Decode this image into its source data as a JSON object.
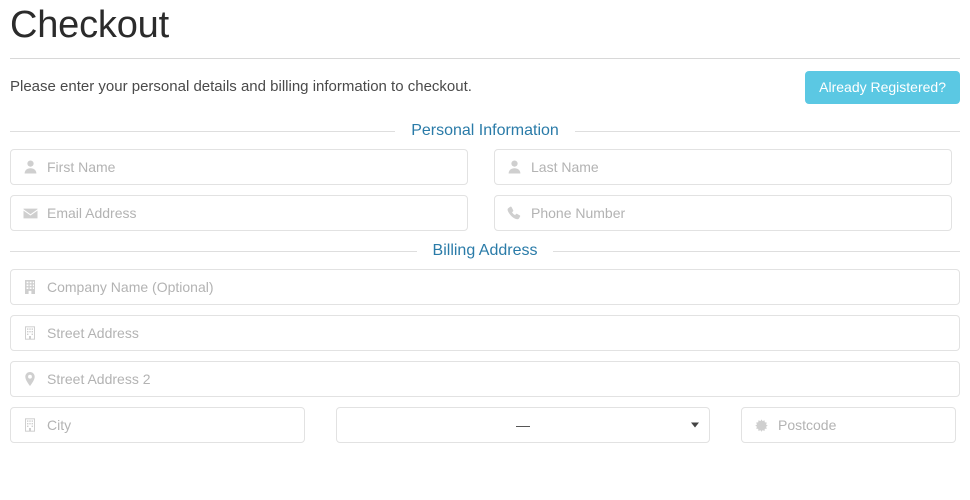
{
  "header": {
    "title": "Checkout",
    "intro": "Please enter your personal details and billing information to checkout.",
    "registered_button": "Already Registered?",
    "registered_button_color": "#5bc8e3"
  },
  "sections": [
    {
      "id": "personal",
      "label": "Personal Information",
      "color": "#2a7ba8"
    },
    {
      "id": "billing",
      "label": "Billing Address",
      "color": "#2a7ba8"
    }
  ],
  "personal_fields": [
    {
      "name": "first-name",
      "icon": "user-icon",
      "placeholder": "First Name",
      "value": ""
    },
    {
      "name": "last-name",
      "icon": "user-icon",
      "placeholder": "Last Name",
      "value": ""
    },
    {
      "name": "email-address",
      "icon": "envelope-icon",
      "placeholder": "Email Address",
      "value": ""
    },
    {
      "name": "phone-number",
      "icon": "phone-icon",
      "placeholder": "Phone Number",
      "value": ""
    }
  ],
  "billing_fields": [
    {
      "name": "company-name",
      "icon": "building-icon",
      "placeholder": "Company Name (Optional)",
      "value": ""
    },
    {
      "name": "street-address",
      "icon": "building-outline-icon",
      "placeholder": "Street Address",
      "value": ""
    },
    {
      "name": "street-address-2",
      "icon": "map-marker-icon",
      "placeholder": "Street Address 2",
      "value": ""
    },
    {
      "name": "city",
      "icon": "building-outline-icon",
      "placeholder": "City",
      "value": ""
    },
    {
      "name": "postcode",
      "icon": "asterisk-burst-icon",
      "placeholder": "Postcode",
      "value": ""
    }
  ],
  "region_select": {
    "name": "region-select",
    "selected": "—",
    "options": [
      "—"
    ]
  },
  "colors": {
    "field_border": "#e2e2e2",
    "placeholder": "#b3b3b3",
    "icon": "#cfcfcf",
    "rule": "#dedede",
    "title_rule": "#d8d8d8",
    "text": "#4a4a4a"
  }
}
